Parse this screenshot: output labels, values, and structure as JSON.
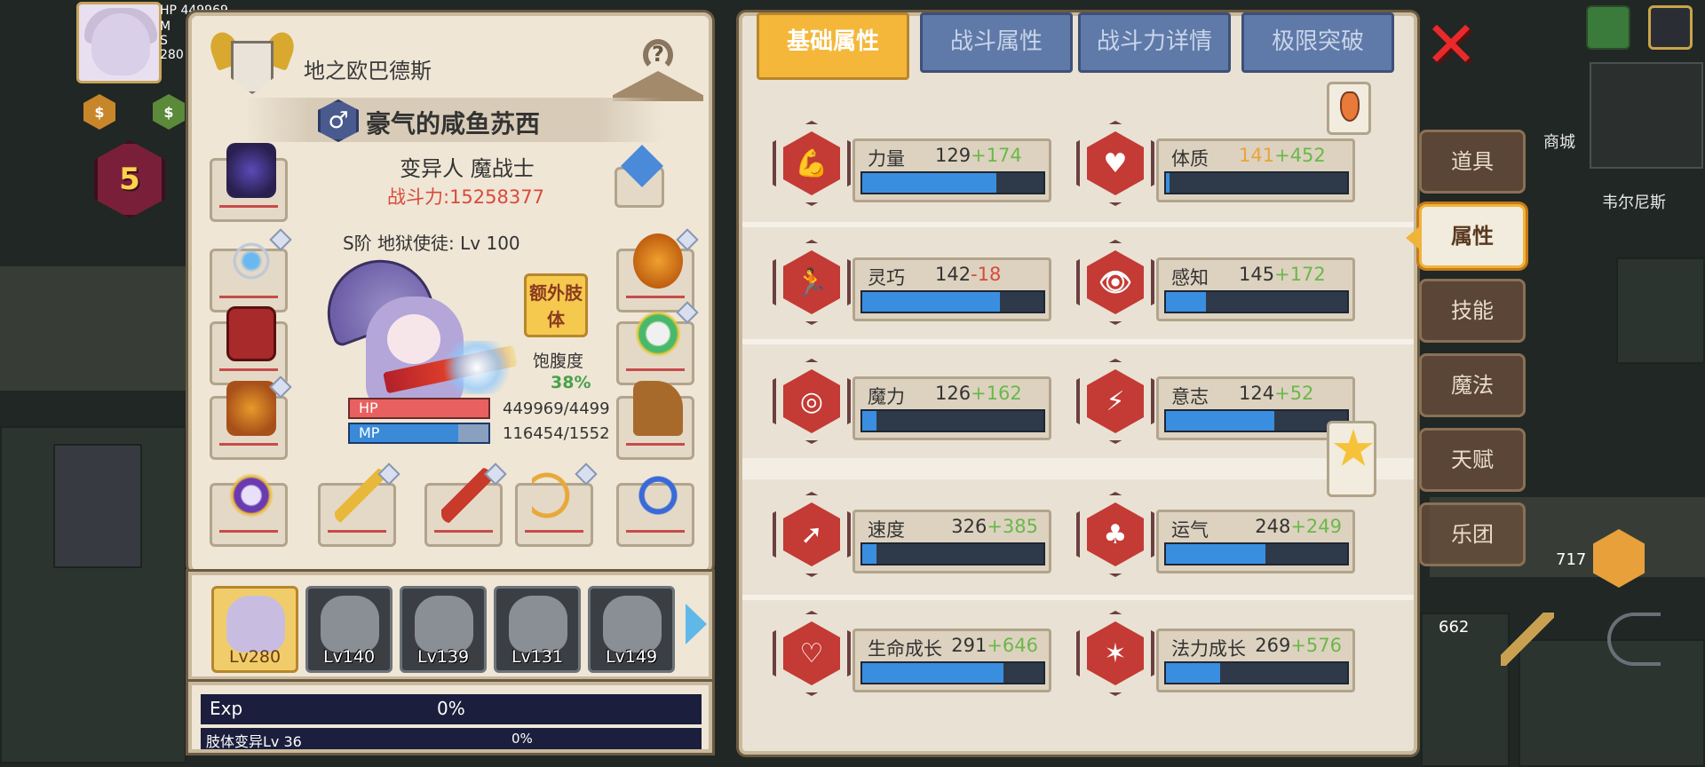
{
  "hud": {
    "hp_label": "HP",
    "hp_value": "449969",
    "mp_label": "M",
    "sp_label": "S",
    "level_badge": "5",
    "power_partial": "280"
  },
  "character": {
    "title": "地之欧巴德斯",
    "gender_symbol": "♂",
    "name": "豪气的咸鱼苏西",
    "class": "变异人 魔战士",
    "power": "战斗力:15258377",
    "rank": "S阶 地狱使徒: Lv 100",
    "extra_limb_button": "额外肢体",
    "hunger_label": "饱腹度",
    "hunger_value": "38%",
    "hp_label": "HP",
    "mp_label": "MP",
    "hp_value": "449969/4499",
    "mp_value": "116454/1552",
    "hp_fill": 1.0,
    "mp_fill": 0.75
  },
  "party": [
    {
      "level": "Lv280",
      "active": true
    },
    {
      "level": "Lv140",
      "active": false
    },
    {
      "level": "Lv139",
      "active": false
    },
    {
      "level": "Lv131",
      "active": false
    },
    {
      "level": "Lv149",
      "active": false
    }
  ],
  "exp": {
    "label": "Exp",
    "percent": "0%",
    "limb_label": "肢体变异Lv 36",
    "limb_percent": "0%"
  },
  "tabs": [
    {
      "label": "基础属性",
      "active": true
    },
    {
      "label": "战斗属性",
      "active": false
    },
    {
      "label": "战斗力详情",
      "active": false
    },
    {
      "label": "极限突破",
      "active": false
    }
  ],
  "stats": [
    {
      "name": "力量",
      "base": "129",
      "bonus": "+174",
      "fill": 0.74,
      "icon": "strength-icon",
      "glyph": "💪"
    },
    {
      "name": "体质",
      "base": "141",
      "bonus": "+452",
      "fill": 0.02,
      "icon": "constitution-icon",
      "glyph": "♥",
      "base_highlight": true
    },
    {
      "name": "灵巧",
      "base": "142",
      "bonus": "-18",
      "fill": 0.76,
      "icon": "agility-icon",
      "glyph": "🏃",
      "negative": true
    },
    {
      "name": "感知",
      "base": "145",
      "bonus": "+172",
      "fill": 0.22,
      "icon": "perception-icon",
      "glyph": "👁"
    },
    {
      "name": "魔力",
      "base": "126",
      "bonus": "+162",
      "fill": 0.08,
      "icon": "magic-icon",
      "glyph": "◎"
    },
    {
      "name": "意志",
      "base": "124",
      "bonus": "+52",
      "fill": 0.6,
      "icon": "will-icon",
      "glyph": "⚡"
    },
    {
      "name": "速度",
      "base": "326",
      "bonus": "+385",
      "fill": 0.08,
      "icon": "speed-icon",
      "glyph": "➚"
    },
    {
      "name": "运气",
      "base": "248",
      "bonus": "+249",
      "fill": 0.55,
      "icon": "luck-icon",
      "glyph": "♣"
    },
    {
      "name": "生命成长",
      "base": "291",
      "bonus": "+646",
      "fill": 0.78,
      "icon": "hp-growth-icon",
      "glyph": "♡"
    },
    {
      "name": "法力成长",
      "base": "269",
      "bonus": "+576",
      "fill": 0.3,
      "icon": "mp-growth-icon",
      "glyph": "✶"
    }
  ],
  "side_menu": [
    {
      "label": "道具",
      "active": false
    },
    {
      "label": "属性",
      "active": true
    },
    {
      "label": "技能",
      "active": false
    },
    {
      "label": "魔法",
      "active": false
    },
    {
      "label": "天赋",
      "active": false
    },
    {
      "label": "乐团",
      "active": false
    }
  ],
  "map": {
    "location": "韦尔尼斯",
    "shop": "商城",
    "count_a": "717",
    "count_b": "662"
  },
  "colors": {
    "tab_active": "#f4b73a",
    "tab_inactive": "#5f7aa8",
    "bonus_positive": "#6ab84a",
    "bonus_negative": "#d84a3a",
    "bar_fill": "#3a8ee0",
    "power_text": "#d94a3a",
    "close": "#e82a2a"
  }
}
